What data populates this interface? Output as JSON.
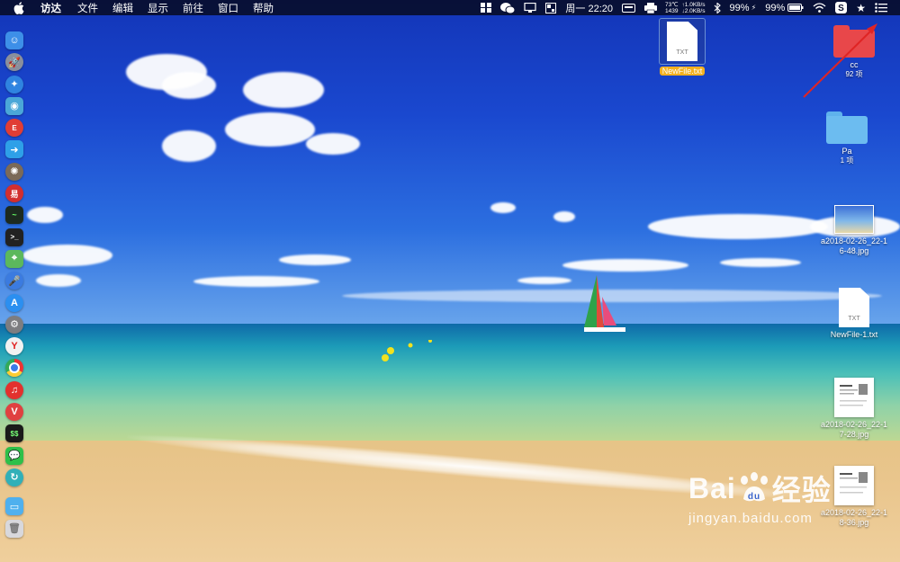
{
  "menubar": {
    "app_name": "访达",
    "menus": [
      "文件",
      "编辑",
      "显示",
      "前往",
      "窗口",
      "帮助"
    ],
    "network": {
      "temp": "73℃",
      "up": "↑1.0KB/s",
      "count": "1439",
      "down": "↓2.0KB/s"
    },
    "clock": "周一 22:20",
    "battery_1": "99%",
    "battery_2": "99%"
  },
  "desktop": {
    "selected_file": "NewFile.txt",
    "txt_tag": "TXT",
    "folder_cc": {
      "name": "cc",
      "count": "92 项",
      "color": "#e8474a"
    },
    "folder_pa": {
      "name": "Pa",
      "count": "1 项",
      "color": "#5fb2ec"
    },
    "image_1": {
      "name_line1": "a2018-02-26_22-1",
      "name_line2": "6-48.jpg"
    },
    "txt_file_2": "NewFile-1.txt",
    "image_2": {
      "name_line1": "a2018-02-26_22-1",
      "name_line2": "7-28.jpg"
    },
    "image_3": {
      "name_line1": "a2018-02-26_22-1",
      "name_line2": "8-36.jpg"
    }
  },
  "dock": {
    "items": [
      {
        "icon": "finder-icon",
        "color": "#3d8fe8"
      },
      {
        "icon": "launchpad-icon",
        "color": "#8a8f9c"
      },
      {
        "icon": "safari-icon",
        "color": "#2f84e0"
      },
      {
        "icon": "preview-icon",
        "color": "#4aa7d8"
      },
      {
        "icon": "app-red-icon",
        "color": "#e03d35"
      },
      {
        "icon": "migration-icon",
        "color": "#2ea0e8"
      },
      {
        "icon": "photo-app-icon",
        "color": "#7b6a58"
      },
      {
        "icon": "netease-icon",
        "color": "#d22e2e"
      },
      {
        "icon": "activity-monitor-icon",
        "color": "#1d2a1f"
      },
      {
        "icon": "terminal-icon",
        "color": "#222"
      },
      {
        "icon": "maps-icon",
        "color": "#5cb85c"
      },
      {
        "icon": "siri-icon",
        "color": "#3b7be0"
      },
      {
        "icon": "app-store-icon",
        "color": "#2b8ff0"
      },
      {
        "icon": "system-preferences-icon",
        "color": "#7d7d80"
      },
      {
        "icon": "yandex-icon",
        "color": "#f2f2f2"
      },
      {
        "icon": "chrome-icon",
        "color": "#f2f2f2"
      },
      {
        "icon": "netease-music-icon",
        "color": "#e3312e"
      },
      {
        "icon": "vivaldi-icon",
        "color": "#e04040"
      },
      {
        "icon": "console-icon",
        "color": "#1a1a1a"
      },
      {
        "icon": "wechat-icon",
        "color": "#2ec04a"
      },
      {
        "icon": "sync-icon",
        "color": "#31b0b8"
      },
      {
        "icon": "folder-icon",
        "color": "#4fb0ee"
      },
      {
        "icon": "trash-icon",
        "color": "#d8d8dc"
      }
    ]
  },
  "watermark": {
    "main": "Bai",
    "main_end": "经验",
    "url": "jingyan.baidu.com"
  }
}
